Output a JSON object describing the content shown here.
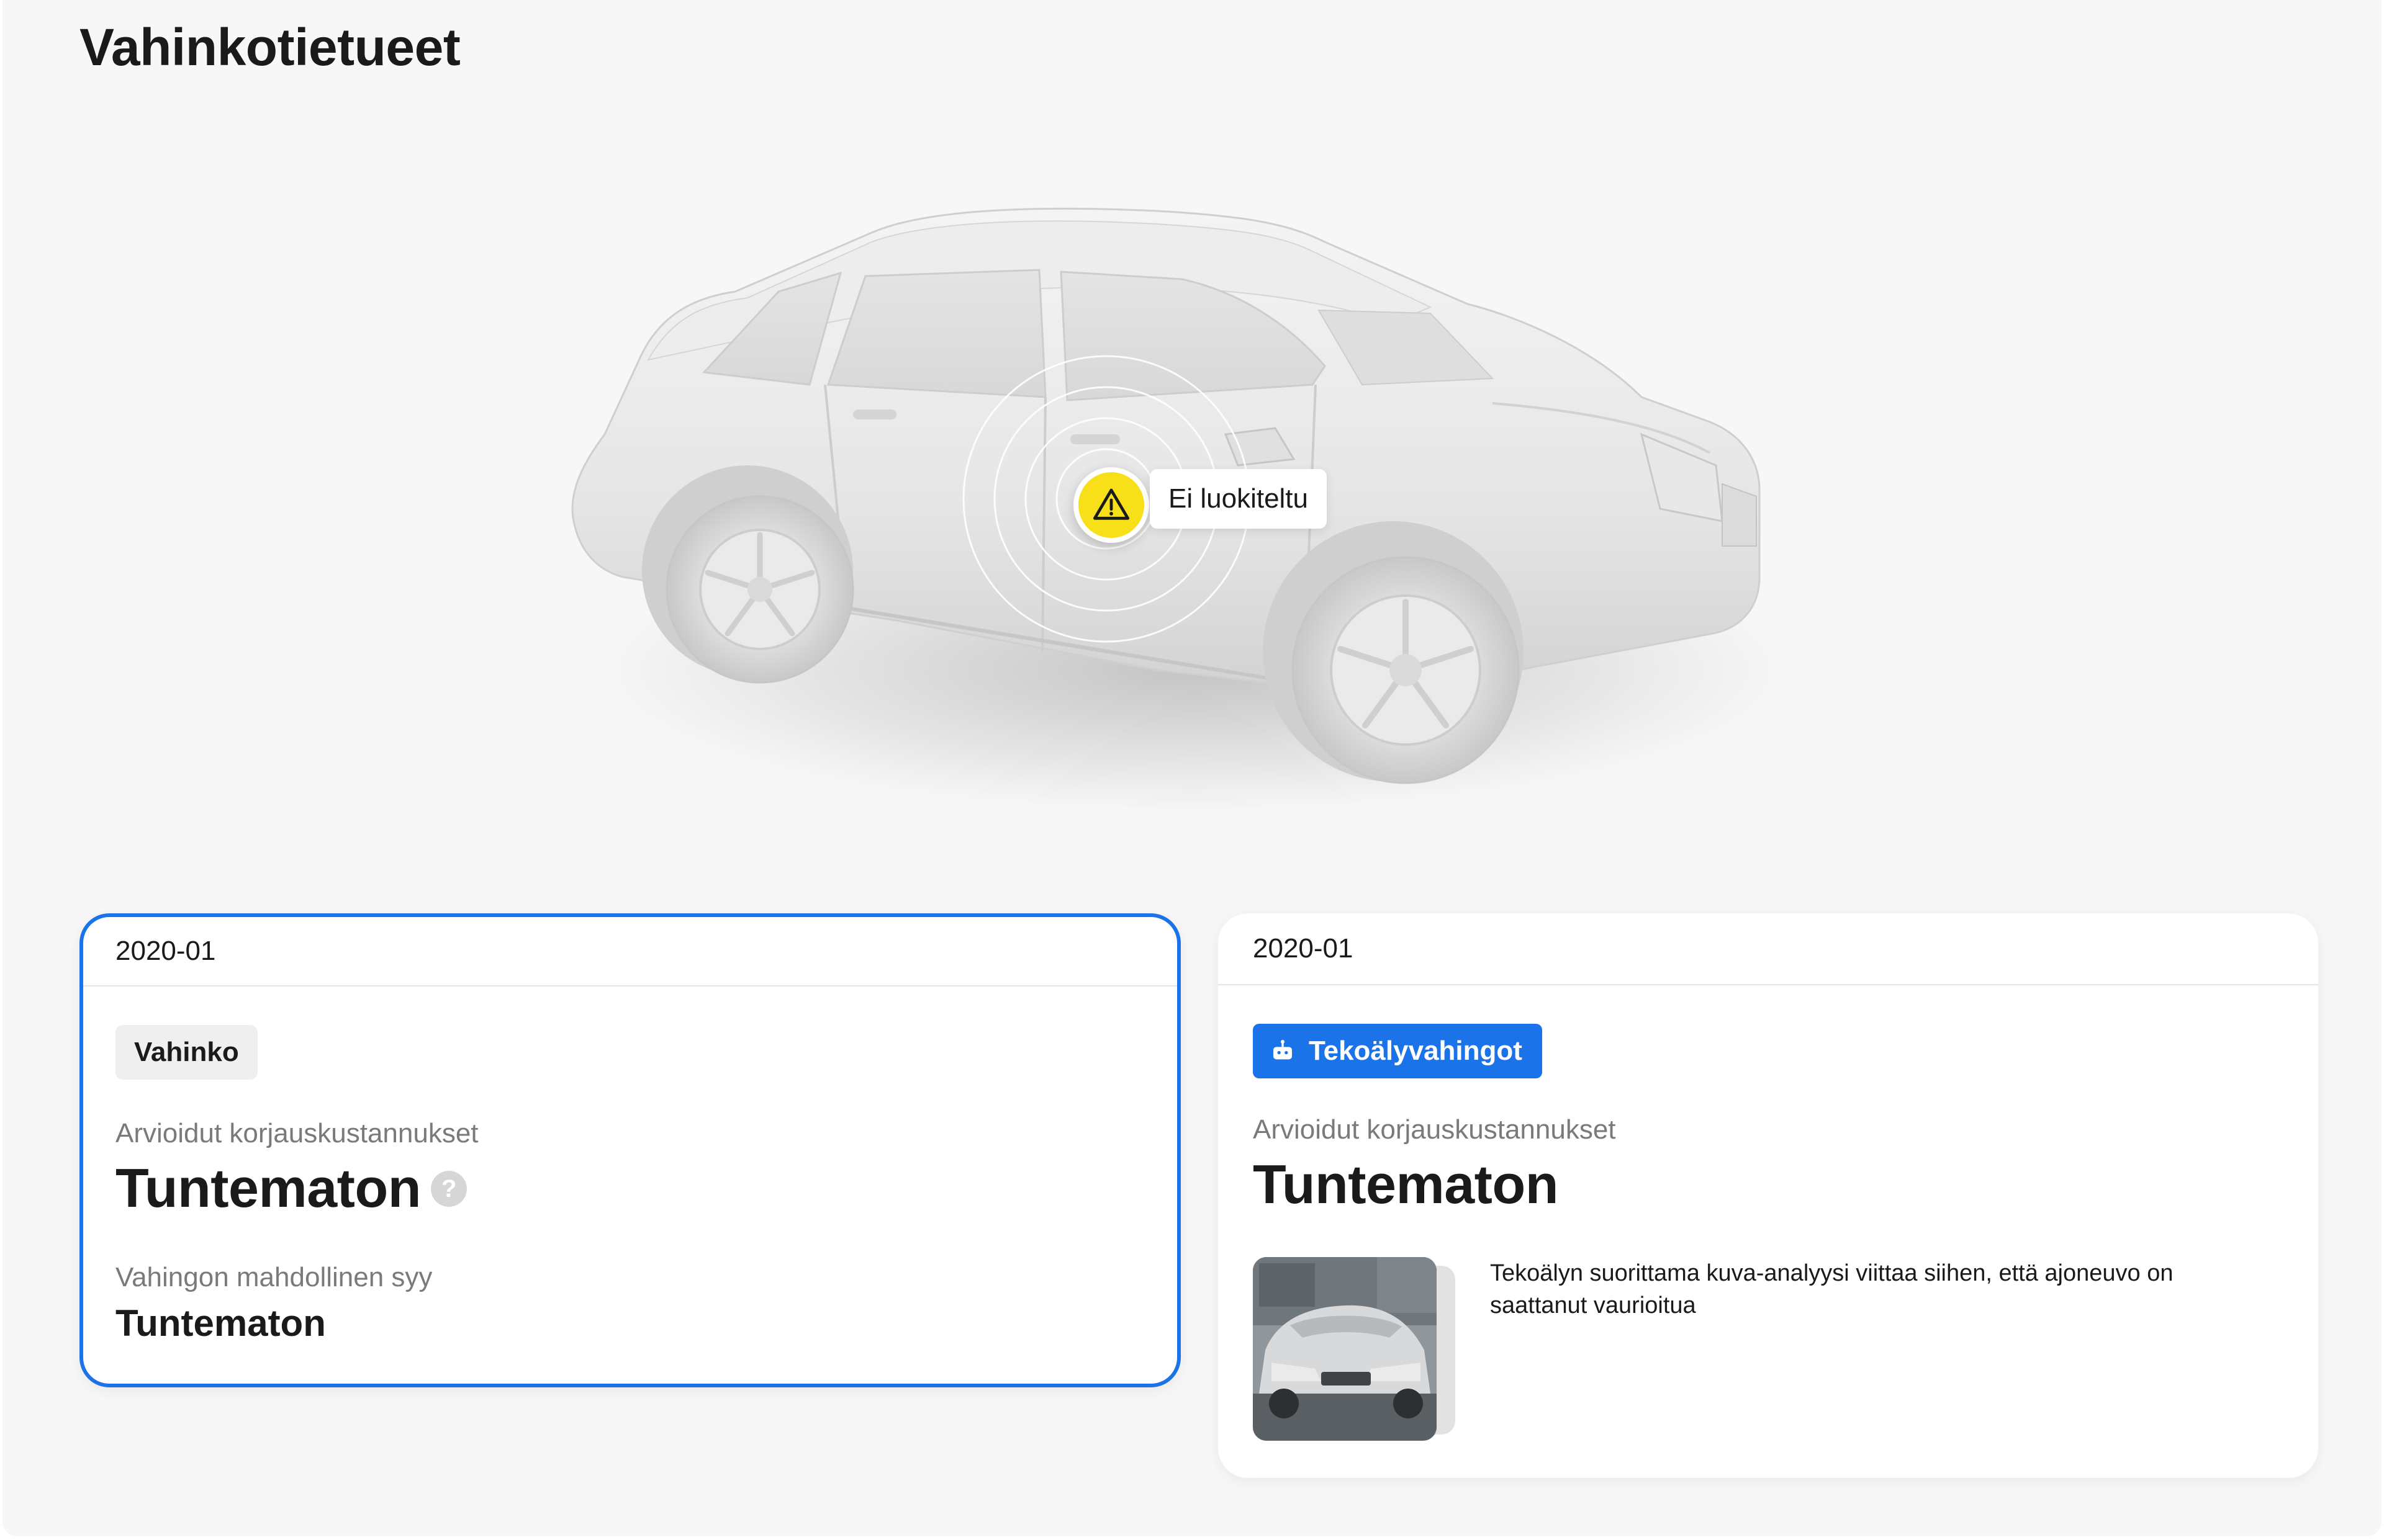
{
  "page": {
    "title": "Vahinkotietueet"
  },
  "marker": {
    "label": "Ei luokiteltu",
    "icon": "warning-icon",
    "color": "#f7e019"
  },
  "cards": [
    {
      "date": "2020-01",
      "tag": "Vahinko",
      "cost_label": "Arvioidut korjauskustannukset",
      "cost_value": "Tuntematon",
      "help_icon": "?",
      "cause_label": "Vahingon mahdollinen syy",
      "cause_value": "Tuntematon",
      "selected": true
    },
    {
      "date": "2020-01",
      "tag": "Tekoälyvahingot",
      "tag_icon": "robot-icon",
      "cost_label": "Arvioidut korjauskustannukset",
      "cost_value": "Tuntematon",
      "note": "Tekoälyn suorittama kuva-analyysi viittaa siihen, että ajoneuvo on saattanut vaurioitua"
    }
  ],
  "colors": {
    "accent": "#1a73e8",
    "warning": "#f7e019",
    "background": "#f7f7f7"
  }
}
